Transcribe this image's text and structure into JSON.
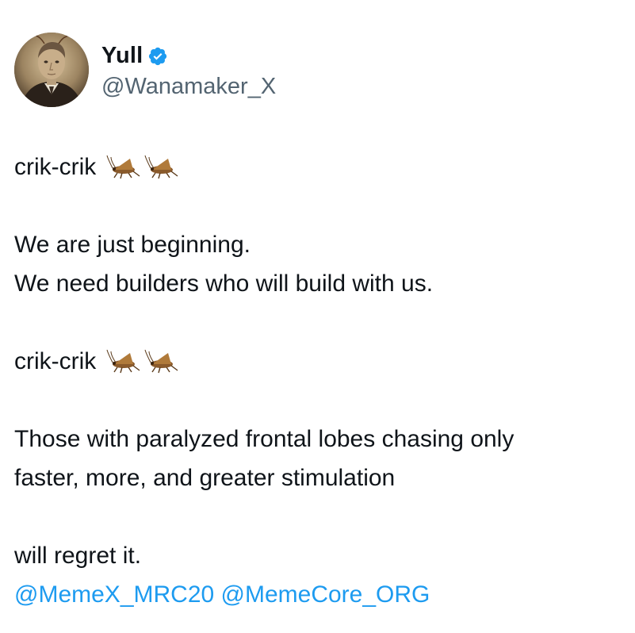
{
  "author": {
    "display_name": "Yull",
    "handle": "@Wanamaker_X",
    "verified": true,
    "verified_icon": "verified-badge-icon",
    "avatar": "vintage-portrait-avatar"
  },
  "post": {
    "lines": [
      {
        "text": "crik-crik",
        "emoji": [
          "cricket",
          "cricket"
        ]
      },
      {
        "text": ""
      },
      {
        "text": "We are just beginning."
      },
      {
        "text": "We need builders who will build with us."
      },
      {
        "text": ""
      },
      {
        "text": "crik-crik",
        "emoji": [
          "cricket",
          "cricket"
        ]
      },
      {
        "text": ""
      },
      {
        "text": "Those with paralyzed frontal lobes chasing only"
      },
      {
        "text": "faster, more, and greater stimulation"
      },
      {
        "text": ""
      },
      {
        "text": "will regret it."
      }
    ],
    "mentions": [
      "@MemeX_MRC20",
      "@MemeCore_ORG"
    ]
  },
  "colors": {
    "text": "#0f1419",
    "secondary": "#536471",
    "link": "#1d9bf0",
    "background": "#ffffff"
  }
}
